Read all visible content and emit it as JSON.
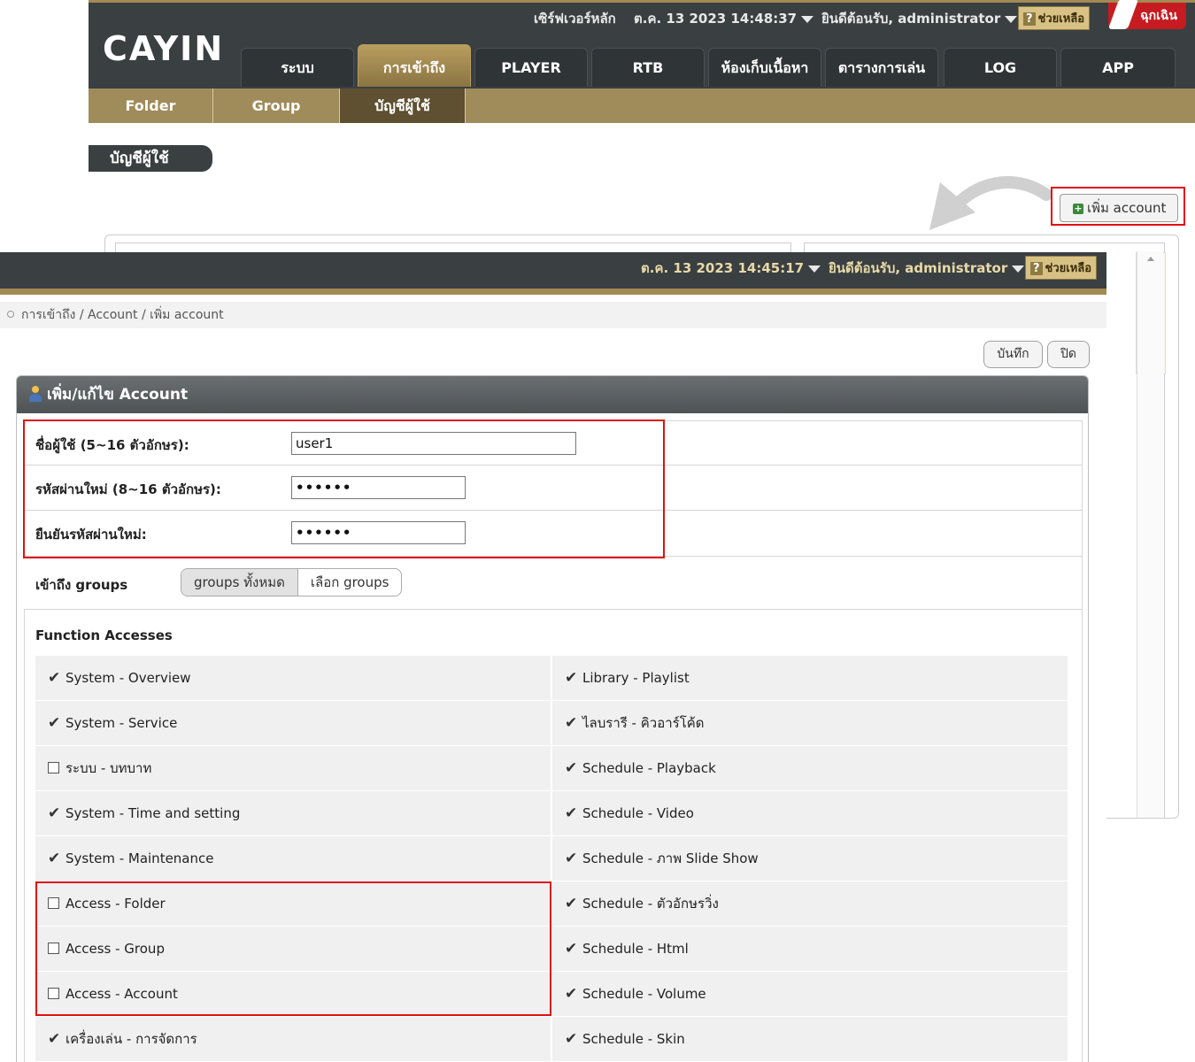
{
  "background_window": {
    "logo": "CAYIN",
    "server_label": "เซิร์ฟเวอร์หลัก",
    "datetime": "ต.ค. 13 2023 14:48:37",
    "welcome": "ยินดีต้อนรับ, administrator",
    "help_label": "ช่วยเหลือ",
    "emergency_label": "ฉุกเฉิน",
    "main_tabs": [
      {
        "label": "ระบบ"
      },
      {
        "label": "การเข้าถึง",
        "active": true
      },
      {
        "label": "PLAYER"
      },
      {
        "label": "RTB"
      },
      {
        "label": "ห้องเก็บเนื้อหา"
      },
      {
        "label": "ตารางการเล่น"
      },
      {
        "label": "LOG"
      },
      {
        "label": "APP"
      }
    ],
    "sub_tabs": [
      {
        "label": "Folder"
      },
      {
        "label": "Group"
      },
      {
        "label": "บัญชีผู้ใช้",
        "active": true
      }
    ],
    "section_heading": "บัญชีผู้ใช้",
    "add_account_button": "เพิ่ม account"
  },
  "foreground_window": {
    "datetime": "ต.ค. 13 2023 14:45:17",
    "welcome": "ยินดีต้อนรับ, administrator",
    "help_label": "ช่วยเหลือ",
    "breadcrumb": "การเข้าถึง / Account / เพิ่ม account",
    "save_button": "บันทึก",
    "close_button": "ปิด",
    "form_title": "เพิ่ม/แก้ไข Account",
    "username_label": "ชื่อผู้ใช้ (5~16 ตัวอักษร):",
    "username_value": "user1",
    "password_label": "รหัสผ่านใหม่ (8~16 ตัวอักษร):",
    "password_value": "••••••",
    "confirm_label": "ยืนยันรหัสผ่านใหม่:",
    "confirm_value": "••••••",
    "groups_label": "เข้าถึง groups",
    "groups_all": "groups ทั้งหมด",
    "groups_select": "เลือก groups",
    "function_accesses_title": "Function Accesses",
    "function_accesses": [
      {
        "left": "System - Overview",
        "left_checked": true,
        "right": "Library - Playlist",
        "right_checked": true
      },
      {
        "left": "System - Service",
        "left_checked": true,
        "right": "ไลบรารี - คิวอาร์โค้ด",
        "right_checked": true
      },
      {
        "left": "ระบบ - บทบาท",
        "left_checked": false,
        "right": "Schedule - Playback",
        "right_checked": true
      },
      {
        "left": "System - Time and setting",
        "left_checked": true,
        "right": "Schedule - Video",
        "right_checked": true
      },
      {
        "left": "System - Maintenance",
        "left_checked": true,
        "right": "Schedule - ภาพ Slide Show",
        "right_checked": true
      },
      {
        "left": "Access - Folder",
        "left_checked": false,
        "right": "Schedule - ตัวอักษรวิ่ง",
        "right_checked": true
      },
      {
        "left": "Access - Group",
        "left_checked": false,
        "right": "Schedule - Html",
        "right_checked": true
      },
      {
        "left": "Access - Account",
        "left_checked": false,
        "right": "Schedule - Volume",
        "right_checked": true
      },
      {
        "left": "เครื่องเล่น - การจัดการ",
        "left_checked": true,
        "right": "Schedule - Skin",
        "right_checked": true
      }
    ]
  },
  "colors": {
    "topbar": "#3a3f42",
    "gold_accent": "#a38a52",
    "highlight_red": "#e01010",
    "emergency_red": "#c51b21"
  }
}
